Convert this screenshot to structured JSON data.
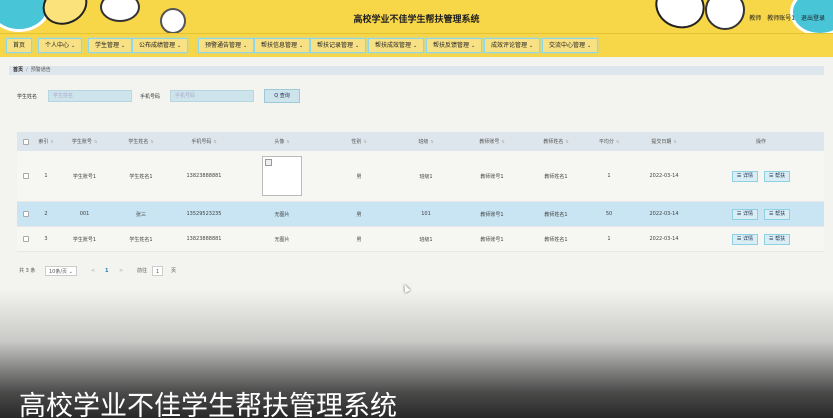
{
  "header": {
    "title": "高校学业不佳学生帮扶管理系统",
    "user_label": "教师",
    "user_name": "教师账号1",
    "logout": "退出登录"
  },
  "nav": [
    {
      "label": "首页",
      "caret": ""
    },
    {
      "label": "个人中心",
      "caret": "⌄"
    },
    {
      "label": "学生管理",
      "caret": "⌄"
    },
    {
      "label": "公布成绩管理",
      "caret": "⌄"
    },
    {
      "label": "预警通告管理",
      "caret": "⌄"
    },
    {
      "label": "帮扶信息管理",
      "caret": "⌄"
    },
    {
      "label": "帮扶记录管理",
      "caret": "⌄"
    },
    {
      "label": "帮扶成效管理",
      "caret": "⌄"
    },
    {
      "label": "帮扶反馈管理",
      "caret": "⌄"
    },
    {
      "label": "成效评论管理",
      "caret": "⌄"
    },
    {
      "label": "交流中心管理",
      "caret": "⌄"
    }
  ],
  "breadcrumb": {
    "home": "首页",
    "sep": "/",
    "current": "预警通告"
  },
  "search": {
    "name_label": "学生姓名",
    "name_placeholder": "学生姓名",
    "phone_label": "手机号码",
    "phone_placeholder": "手机号码",
    "button": "Q 查询"
  },
  "table": {
    "headers": [
      "索引",
      "学生账号",
      "学生姓名",
      "手机号码",
      "头像",
      "性别",
      "班级",
      "教师账号",
      "教师姓名",
      "平均分",
      "提交日期",
      "操作"
    ],
    "rows": [
      {
        "index": "1",
        "account": "学生账号1",
        "name": "学生姓名1",
        "phone": "13823888881",
        "avatar": "",
        "gender": "男",
        "class": "班级1",
        "teacher_account": "教师账号1",
        "teacher_name": "教师姓名1",
        "score": "1",
        "date": "2022-03-14"
      },
      {
        "index": "2",
        "account": "001",
        "name": "张三",
        "phone": "13529523235",
        "avatar": "无图片",
        "gender": "男",
        "class": "101",
        "teacher_account": "教师账号1",
        "teacher_name": "教师姓名1",
        "score": "50",
        "date": "2022-03-14"
      },
      {
        "index": "3",
        "account": "学生账号1",
        "name": "学生姓名1",
        "phone": "13823888881",
        "avatar": "无图片",
        "gender": "男",
        "class": "班级1",
        "teacher_account": "教师账号1",
        "teacher_name": "教师姓名1",
        "score": "1",
        "date": "2022-03-14"
      }
    ],
    "sort_icon": "sort-icon",
    "action_detail": "☰ 详情",
    "action_help": "☰ 帮扶"
  },
  "pager": {
    "total": "共 3 条",
    "page_size": "10条/页",
    "prev": "<",
    "current": "1",
    "next": ">",
    "goto_label": "前往",
    "goto_value": "1",
    "goto_unit": "页"
  },
  "banner": "高校学业不佳学生帮扶管理系统",
  "colors": {
    "header_bg": "#f7d648",
    "accent_border": "#8fd7e6",
    "selected_row": "#c9e4f2"
  }
}
